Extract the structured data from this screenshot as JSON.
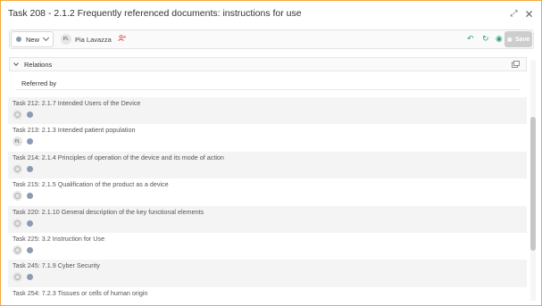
{
  "window": {
    "title": "Task 208 - 2.1.2 Frequently referenced documents: instructions for use",
    "expand_glyph": "⤢",
    "close_glyph": "✕"
  },
  "toolbar": {
    "status": {
      "label": "New",
      "color": "#8a9bb3"
    },
    "assignee": {
      "initials": "PL",
      "name": "Pia Lavazza",
      "remove_icon": "user-remove-icon"
    },
    "actions": {
      "undo_glyph": "↶",
      "refresh_glyph": "↻",
      "watch_glyph": "◉"
    },
    "save_label": "Save",
    "save_glyph": "▣"
  },
  "relations": {
    "header": "Relations",
    "subsection": "Referred by",
    "items": [
      {
        "title": "Task 212: 2.1.7 Intended Users of the Device",
        "avatar": "👤"
      },
      {
        "title": "Task 213: 2.1.3 Intended patient population",
        "avatar": "PL"
      },
      {
        "title": "Task 214: 2.1.4 Principles of operation of the device and its mode of action",
        "avatar": "👤"
      },
      {
        "title": "Task 215: 2.1.5 Qualification of the product as a device",
        "avatar": "👤"
      },
      {
        "title": "Task 220: 2.1.10 General description of the key functional elements",
        "avatar": "👤"
      },
      {
        "title": "Task 225: 3.2 Instruction for Use",
        "avatar": "👤"
      },
      {
        "title": "Task 245: 7.1.9 Cyber Security",
        "avatar": "👤"
      },
      {
        "title": "Task 254: 7.2.3 Tissues or cells of human origin",
        "avatar": ""
      }
    ]
  },
  "colors": {
    "accent_border": "#f2a93b",
    "action_green": "#3aa07a",
    "remove_red": "#d9534f"
  }
}
